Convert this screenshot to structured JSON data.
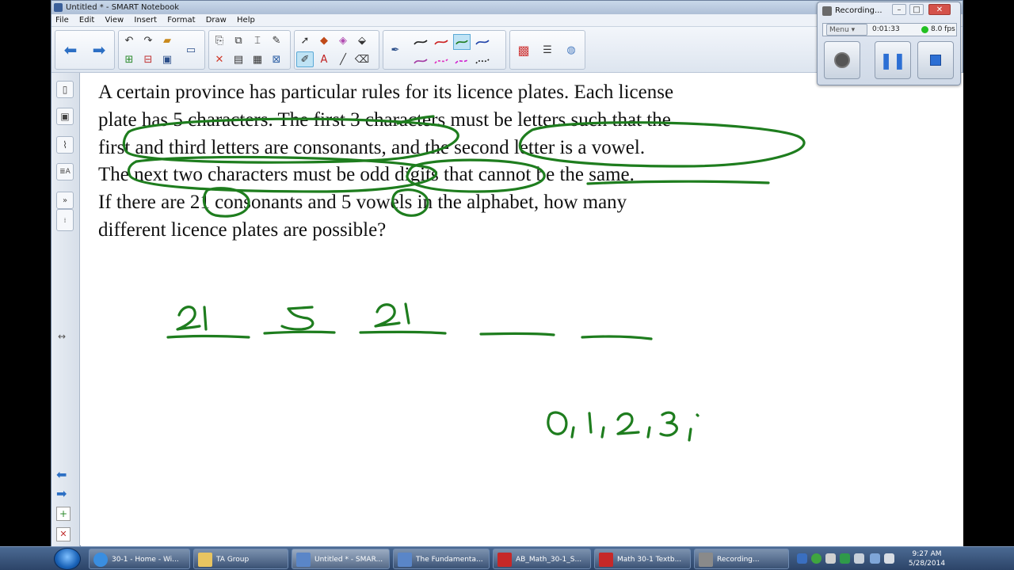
{
  "window": {
    "title": "Untitled * - SMART Notebook"
  },
  "menu": [
    "File",
    "Edit",
    "View",
    "Insert",
    "Format",
    "Draw",
    "Help"
  ],
  "problem": {
    "lines": [
      "A certain province has particular rules for its licence plates.  Each license",
      "plate has 5 characters.  The first 3 characters must be letters such that the",
      "first and third letters are consonants, and the second letter is a vowel.",
      "The next two characters must be odd digits that cannot be the same.",
      "If there are 21 consonants and 5 vowels in the alphabet, how many",
      "different licence plates are possible?"
    ]
  },
  "handwriting": {
    "slots": [
      "21",
      "5",
      "21",
      "",
      ""
    ],
    "digits": "0,1,2,3,"
  },
  "ink_color": "#1e7d1e",
  "recorder": {
    "title": "Recording...",
    "menu_label": "Menu",
    "elapsed": "0:01:33",
    "fps": "8.0 fps",
    "status_color": "#22c022"
  },
  "taskbar": {
    "items": [
      {
        "label": "30-1 - Home - Wi...",
        "icon": "ie-icon"
      },
      {
        "label": "TA Group",
        "icon": "folder-icon"
      },
      {
        "label": "Untitled * - SMAR...",
        "icon": "smart-notebook-icon"
      },
      {
        "label": "The Fundamenta...",
        "icon": "smart-notebook-icon"
      },
      {
        "label": "AB_Math_30-1_S...",
        "icon": "pdf-icon"
      },
      {
        "label": "Math 30-1 Textb...",
        "icon": "pdf-icon"
      },
      {
        "label": "Recording...",
        "icon": "recorder-icon"
      }
    ],
    "time": "9:27 AM",
    "date": "5/28/2014"
  }
}
